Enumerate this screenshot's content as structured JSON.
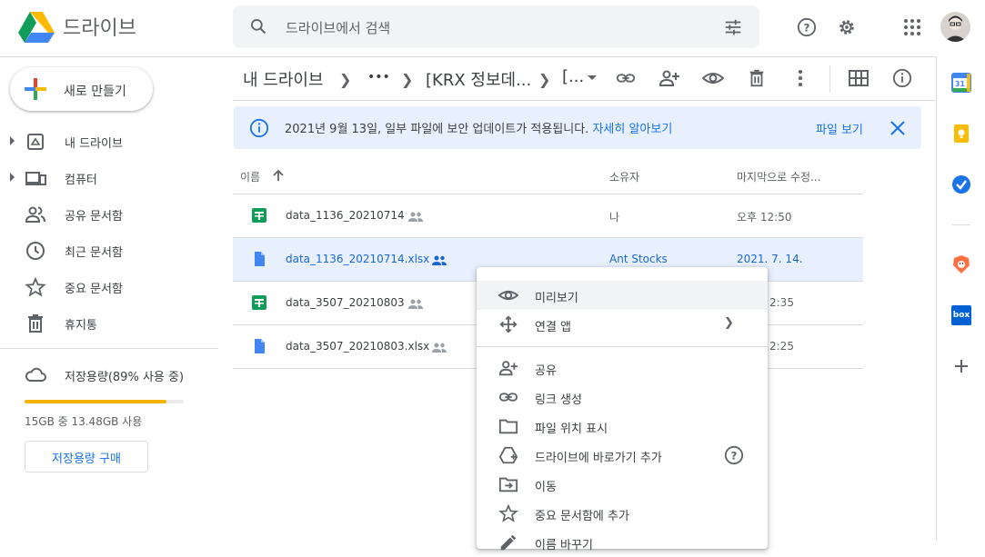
{
  "header": {
    "app_title": "드라이브",
    "search_placeholder": "드라이브에서 검색"
  },
  "sidebar": {
    "new_button_label": "새로 만들기",
    "items": [
      {
        "label": "내 드라이브",
        "icon": "my-drive-icon"
      },
      {
        "label": "컴퓨터",
        "icon": "computer-icon"
      },
      {
        "label": "공유 문서함",
        "icon": "shared-people-icon"
      },
      {
        "label": "최근 문서함",
        "icon": "clock-icon"
      },
      {
        "label": "중요 문서함",
        "icon": "star-icon"
      },
      {
        "label": "휴지통",
        "icon": "trash-icon"
      }
    ],
    "storage": {
      "label": "저장용량(89% 사용 중)",
      "percent_used": 89,
      "usage_text": "15GB 중 13.48GB 사용",
      "buy_button": "저장용량 구매"
    }
  },
  "breadcrumb": {
    "root": "내 드라이브",
    "ellipsis": "•••",
    "folder": "[KRX 정보데...",
    "current": "[..."
  },
  "banner": {
    "message": "2021년 9월 13일, 일부 파일에 보안 업데이트가 적용됩니다.",
    "link": "자세히 알아보기",
    "action": "파일 보기"
  },
  "file_list": {
    "columns": {
      "name": "이름",
      "owner": "소유자",
      "modified": "마지막으로 수정..."
    },
    "rows": [
      {
        "name": "data_1136_20210714",
        "type": "sheets",
        "owner": "나",
        "modified": "오후 12:50"
      },
      {
        "name": "data_1136_20210714.xlsx",
        "type": "doc",
        "owner": "Ant Stocks",
        "modified": "2021. 7. 14."
      },
      {
        "name": "data_3507_20210803",
        "type": "sheets",
        "owner": "",
        "modified": "2:35"
      },
      {
        "name": "data_3507_20210803.xlsx",
        "type": "doc",
        "owner": "",
        "modified": "2:25"
      }
    ]
  },
  "context_menu": {
    "items": [
      {
        "label": "미리보기",
        "icon": "eye-icon"
      },
      {
        "label": "연결 앱",
        "icon": "move-arrows-icon"
      },
      {
        "label": "공유",
        "icon": "add-person-icon"
      },
      {
        "label": "링크 생성",
        "icon": "link-icon"
      },
      {
        "label": "파일 위치 표시",
        "icon": "folder-icon"
      },
      {
        "label": "드라이브에 바로가기 추가",
        "icon": "drive-shortcut-icon"
      },
      {
        "label": "이동",
        "icon": "move-to-folder-icon"
      },
      {
        "label": "중요 문서함에 추가",
        "icon": "star-icon"
      },
      {
        "label": "이름 바꾸기",
        "icon": "pencil-icon"
      }
    ]
  },
  "side_panel": {
    "calendar_day": "31",
    "box_label": "box"
  },
  "colors": {
    "accent_blue": "#1a73e8",
    "selected_row_bg": "#e8f0fe",
    "storage_bar": "#f4b400",
    "sheets_green": "#0f9d58",
    "doc_blue": "#4285f4"
  }
}
